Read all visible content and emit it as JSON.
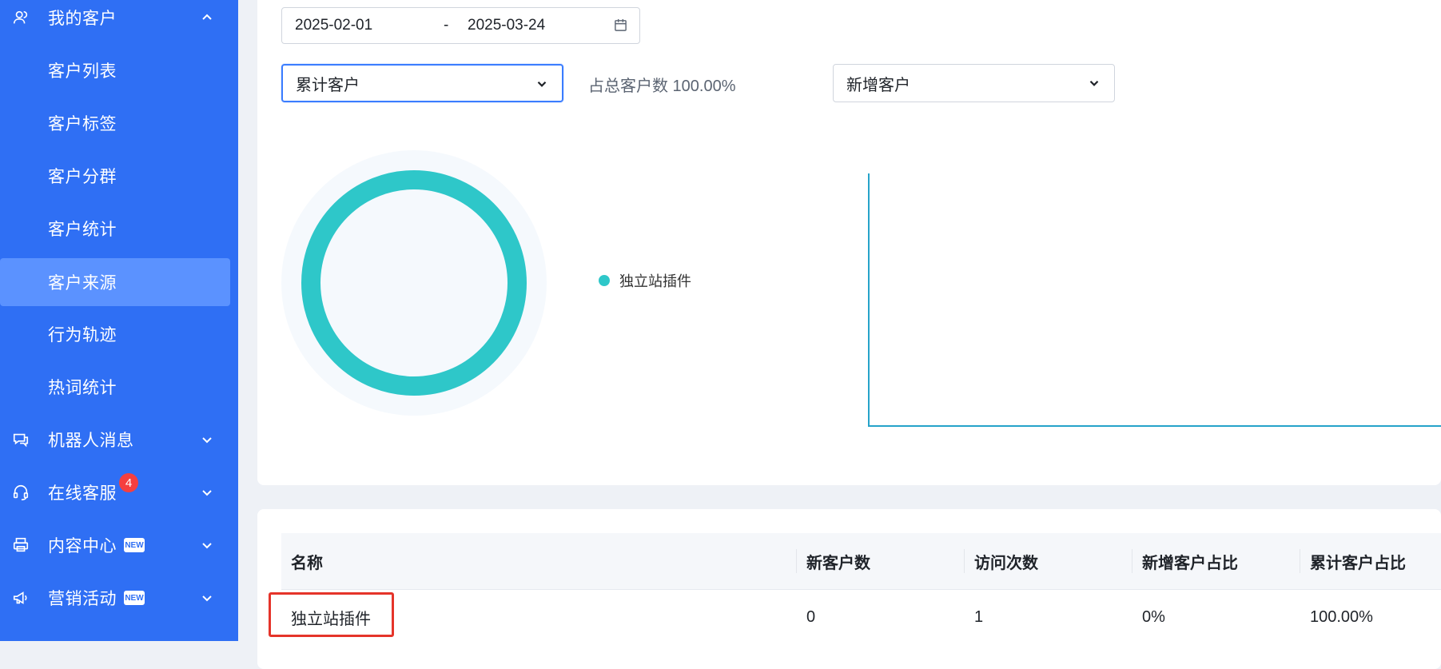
{
  "sidebar": {
    "groups": [
      {
        "label": "我的客户",
        "icon": "user-icon",
        "expanded": true
      },
      {
        "label": "机器人消息",
        "icon": "chat-icon"
      },
      {
        "label": "在线客服",
        "icon": "headset-icon",
        "badge": "4"
      },
      {
        "label": "内容中心",
        "icon": "printer-icon",
        "tag": "NEW"
      },
      {
        "label": "营销活动",
        "icon": "megaphone-icon",
        "tag": "NEW"
      }
    ],
    "sub_items": [
      "客户列表",
      "客户标签",
      "客户分群",
      "客户统计",
      "客户来源",
      "行为轨迹",
      "热词统计"
    ],
    "active_item": "客户来源"
  },
  "filters": {
    "date_start": "2025-02-01",
    "date_separator": "-",
    "date_end": "2025-03-24",
    "metric_select": "累计客户",
    "ratio_text": "占总客户数 100.00%",
    "trend_select": "新增客户"
  },
  "chart_data": {
    "type": "pie",
    "categories": [
      "独立站插件"
    ],
    "values": [
      100
    ],
    "colors": [
      "#2ec7c9"
    ]
  },
  "legend": {
    "label": "独立站插件",
    "color": "#2ec7c9"
  },
  "table": {
    "columns": [
      "名称",
      "新客户数",
      "访问次数",
      "新增客户占比",
      "累计客户占比"
    ],
    "rows": [
      [
        "独立站插件",
        "0",
        "1",
        "0%",
        "100.00%"
      ]
    ]
  },
  "colors": {
    "sidebar": "#2f6ff4",
    "active": "#5b92ff",
    "accent": "#2ec7c9",
    "highlight": "#e5342a"
  }
}
